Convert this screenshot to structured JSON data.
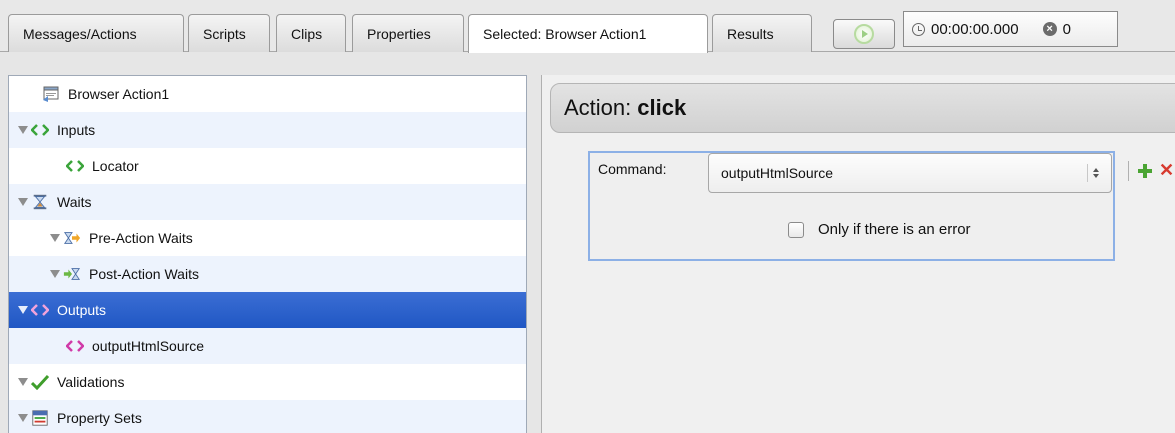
{
  "tabs": [
    {
      "label": "Messages/Actions"
    },
    {
      "label": "Scripts"
    },
    {
      "label": "Clips"
    },
    {
      "label": "Properties"
    },
    {
      "label": "Selected: Browser Action1"
    },
    {
      "label": "Results"
    }
  ],
  "timer": {
    "time": "00:00:00.000",
    "errors": "0"
  },
  "tree": {
    "items": [
      {
        "label": "Browser Action1"
      },
      {
        "label": "Inputs"
      },
      {
        "label": "Locator"
      },
      {
        "label": "Waits"
      },
      {
        "label": "Pre-Action Waits"
      },
      {
        "label": "Post-Action Waits"
      },
      {
        "label": "Outputs"
      },
      {
        "label": "outputHtmlSource"
      },
      {
        "label": "Validations"
      },
      {
        "label": "Property Sets"
      }
    ]
  },
  "action": {
    "prefix": "Action:",
    "name": "click",
    "command_label": "Command:",
    "command_value": "outputHtmlSource",
    "checkbox_label": "Only if there is an error"
  },
  "colors": {
    "selection": "#2b62cc",
    "code_green": "#3aa43a",
    "code_pink": "#d03aa8"
  }
}
